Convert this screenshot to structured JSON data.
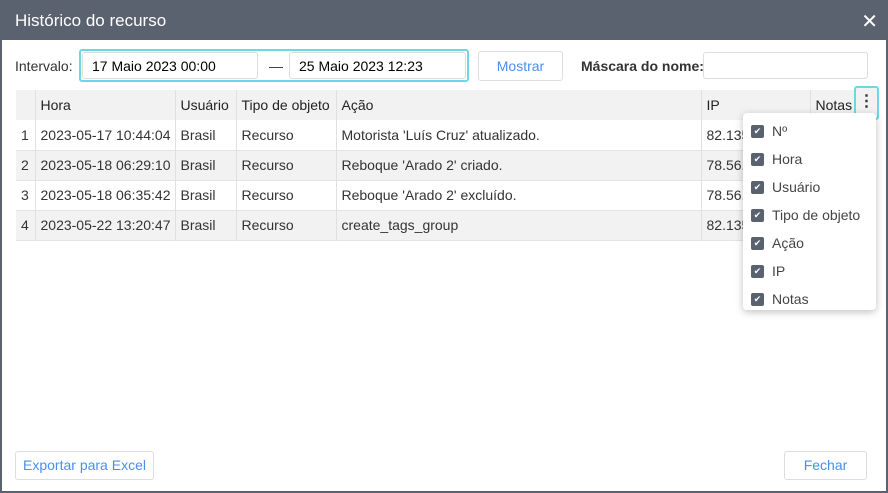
{
  "title": "Histórico do recurso",
  "filters": {
    "interval_label": "Intervalo:",
    "from": "17 Maio 2023 00:00",
    "separator": "—",
    "to": "25 Maio 2023 12:23",
    "show_button": "Mostrar",
    "name_mask_label": "Máscara do nome:",
    "name_mask_value": ""
  },
  "table": {
    "headers": [
      "",
      "Hora",
      "Usuário",
      "Tipo de objeto",
      "Ação",
      "IP",
      "Notas"
    ],
    "rows": [
      [
        "1",
        "2023-05-17 10:44:04",
        "Brasil",
        "Recurso",
        "Motorista 'Luís Cruz' atualizado.",
        "82.135",
        ""
      ],
      [
        "2",
        "2023-05-18 06:29:10",
        "Brasil",
        "Recurso",
        "Reboque 'Arado 2' criado.",
        "78.56.",
        ""
      ],
      [
        "3",
        "2023-05-18 06:35:42",
        "Brasil",
        "Recurso",
        "Reboque 'Arado 2' excluído.",
        "78.56.",
        ""
      ],
      [
        "4",
        "2023-05-22 13:20:47",
        "Brasil",
        "Recurso",
        "create_tags_group",
        "82.135",
        ""
      ]
    ]
  },
  "column_menu": [
    {
      "label": "Nº",
      "checked": true
    },
    {
      "label": "Hora",
      "checked": true
    },
    {
      "label": "Usuário",
      "checked": true
    },
    {
      "label": "Tipo de objeto",
      "checked": true
    },
    {
      "label": "Ação",
      "checked": true
    },
    {
      "label": "IP",
      "checked": true
    },
    {
      "label": "Notas",
      "checked": true
    }
  ],
  "footer": {
    "export": "Exportar para Excel",
    "close": "Fechar"
  }
}
